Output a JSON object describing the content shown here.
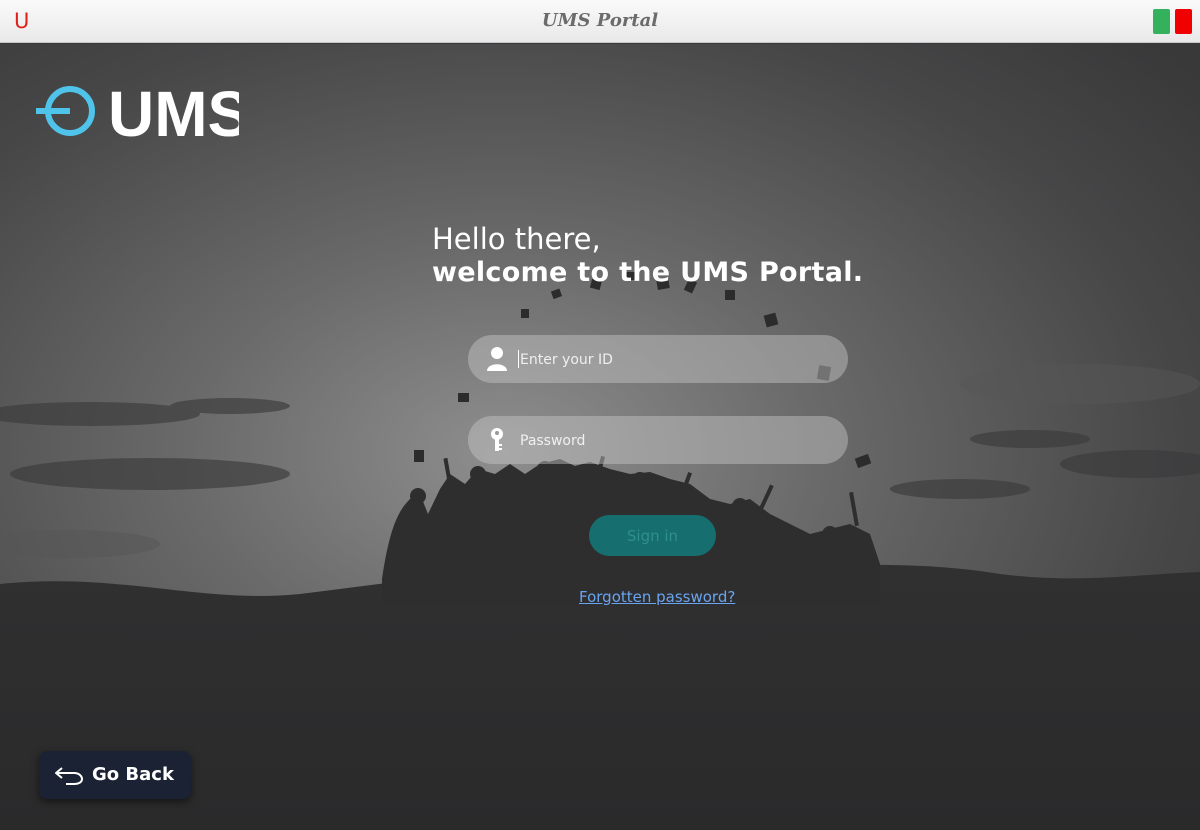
{
  "window": {
    "title": "UMS Portal",
    "app_icon_glyph": "U",
    "buttons": [
      {
        "name": "maximize",
        "color": "#33b15d"
      },
      {
        "name": "close",
        "color": "#f00000"
      }
    ]
  },
  "logo": {
    "text": "UMS",
    "accent_color": "#4fc3ea"
  },
  "greeting": {
    "line1": "Hello there,",
    "line2": "welcome to the UMS Portal."
  },
  "form": {
    "id_placeholder": "Enter your ID",
    "id_value": "",
    "password_placeholder": "Password",
    "password_value": "",
    "signin_label": "Sign in",
    "forgot_label": "Forgotten password?"
  },
  "go_back": {
    "label": "Go Back",
    "icon": "return-arrow-icon"
  },
  "icons": {
    "user": "user-icon",
    "key": "key-icon"
  },
  "colors": {
    "signin_bg": "#166e6e",
    "link": "#6aa4f0",
    "go_back_bg": "#1a2233"
  }
}
